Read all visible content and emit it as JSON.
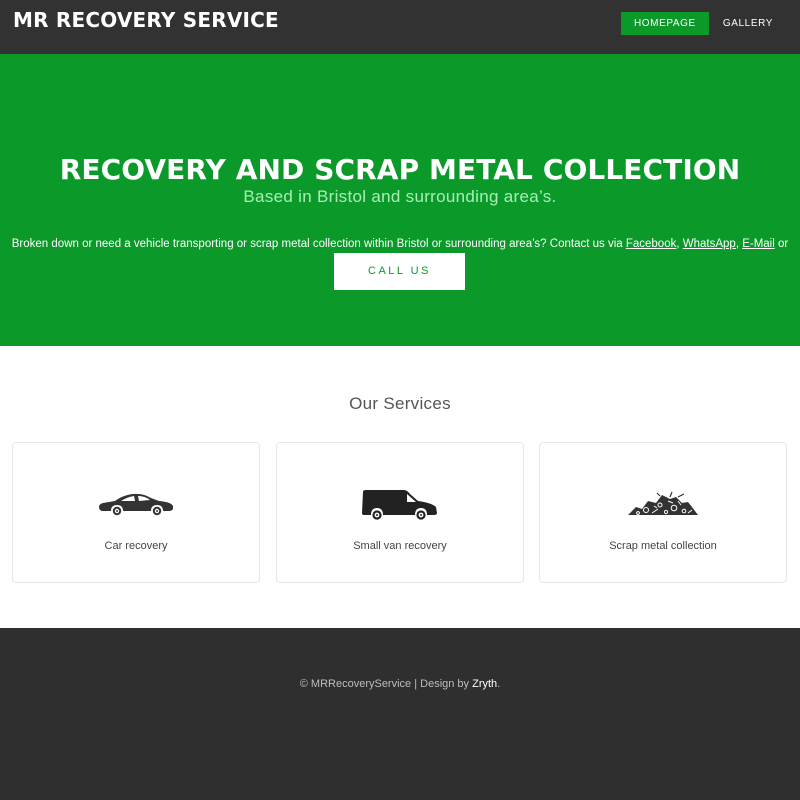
{
  "header": {
    "brand": "MR RECOVERY SERVICE",
    "nav": [
      {
        "label": "HOMEPAGE",
        "active": true
      },
      {
        "label": "GALLERY",
        "active": false
      }
    ]
  },
  "hero": {
    "title": "RECOVERY AND SCRAP METAL COLLECTION",
    "subtitle": "Based in Bristol and surrounding area’s.",
    "desc_before": "Broken down or need a vehicle transporting or scrap metal collection within Bristol or surrounding area’s? Contact us via ",
    "link_facebook": "Facebook",
    "sep1": ", ",
    "link_whatsapp": "WhatsApp",
    "sep2": ", ",
    "link_email": "E-Mail",
    "desc_after": " or call us with the link below.",
    "call_button": "CALL US"
  },
  "services": {
    "heading": "Our Services",
    "items": [
      {
        "label": "Car recovery",
        "icon": "car-icon"
      },
      {
        "label": "Small van recovery",
        "icon": "van-icon"
      },
      {
        "label": "Scrap metal collection",
        "icon": "scrap-pile-icon"
      }
    ]
  },
  "footer": {
    "copyright": "© MRRecoveryService | Design by ",
    "designer": "Zryth",
    "period": "."
  },
  "colors": {
    "accent": "#0b9a2a",
    "header_bg": "#333232",
    "footer_bg": "#2f2f2f"
  }
}
